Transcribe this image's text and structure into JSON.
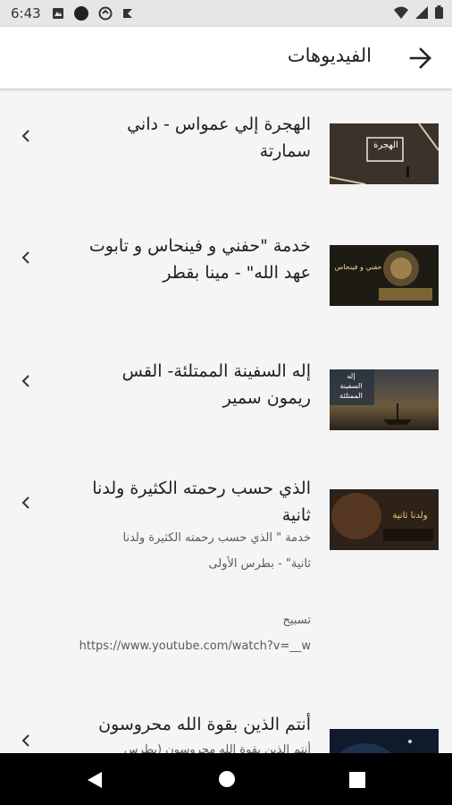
{
  "status_bar": {
    "time": "6:43"
  },
  "app_bar": {
    "title": "الفيديوهات"
  },
  "videos": [
    {
      "title_line1": "الهجرة إلي عمواس - داني",
      "title_line2": "سمارتة",
      "thumb_text": "الهجرة"
    },
    {
      "title_line1": "خدمة \"حفني و فينحاس و تابوت",
      "title_line2": "عهد الله\" - مينا بقطر",
      "thumb_text": "حفني و فينحاس"
    },
    {
      "title_line1": "إله السفينة الممتلئة- القس",
      "title_line2": "ريمون سمير",
      "thumb_text_1": "إله",
      "thumb_text_2": "السفينة",
      "thumb_text_3": "الممتلئة"
    },
    {
      "title_line1": "الذي حسب رحمته الكثيرة ولدنا",
      "title_line2": "ثانية",
      "desc_line1": "خدمة \" الذي حسب رحمته الكثيرة ولدنا",
      "desc_line2": "ثانية\" - بطرس الأولى",
      "desc_line3": "تسبيح",
      "desc_line4": "https://www.youtube.com/watch?v=__w",
      "thumb_text": "ولدنا ثانية"
    },
    {
      "title_line1": "أنتم الذين بقوة الله محروسون",
      "desc_line1": "أنتم الذين بقوة الله محروسون (بطرس"
    }
  ],
  "colors": {
    "status_bar": "#e6e6e6",
    "app_bar": "#ffffff",
    "background": "#f5f5f5",
    "nav_bar": "#000000"
  }
}
